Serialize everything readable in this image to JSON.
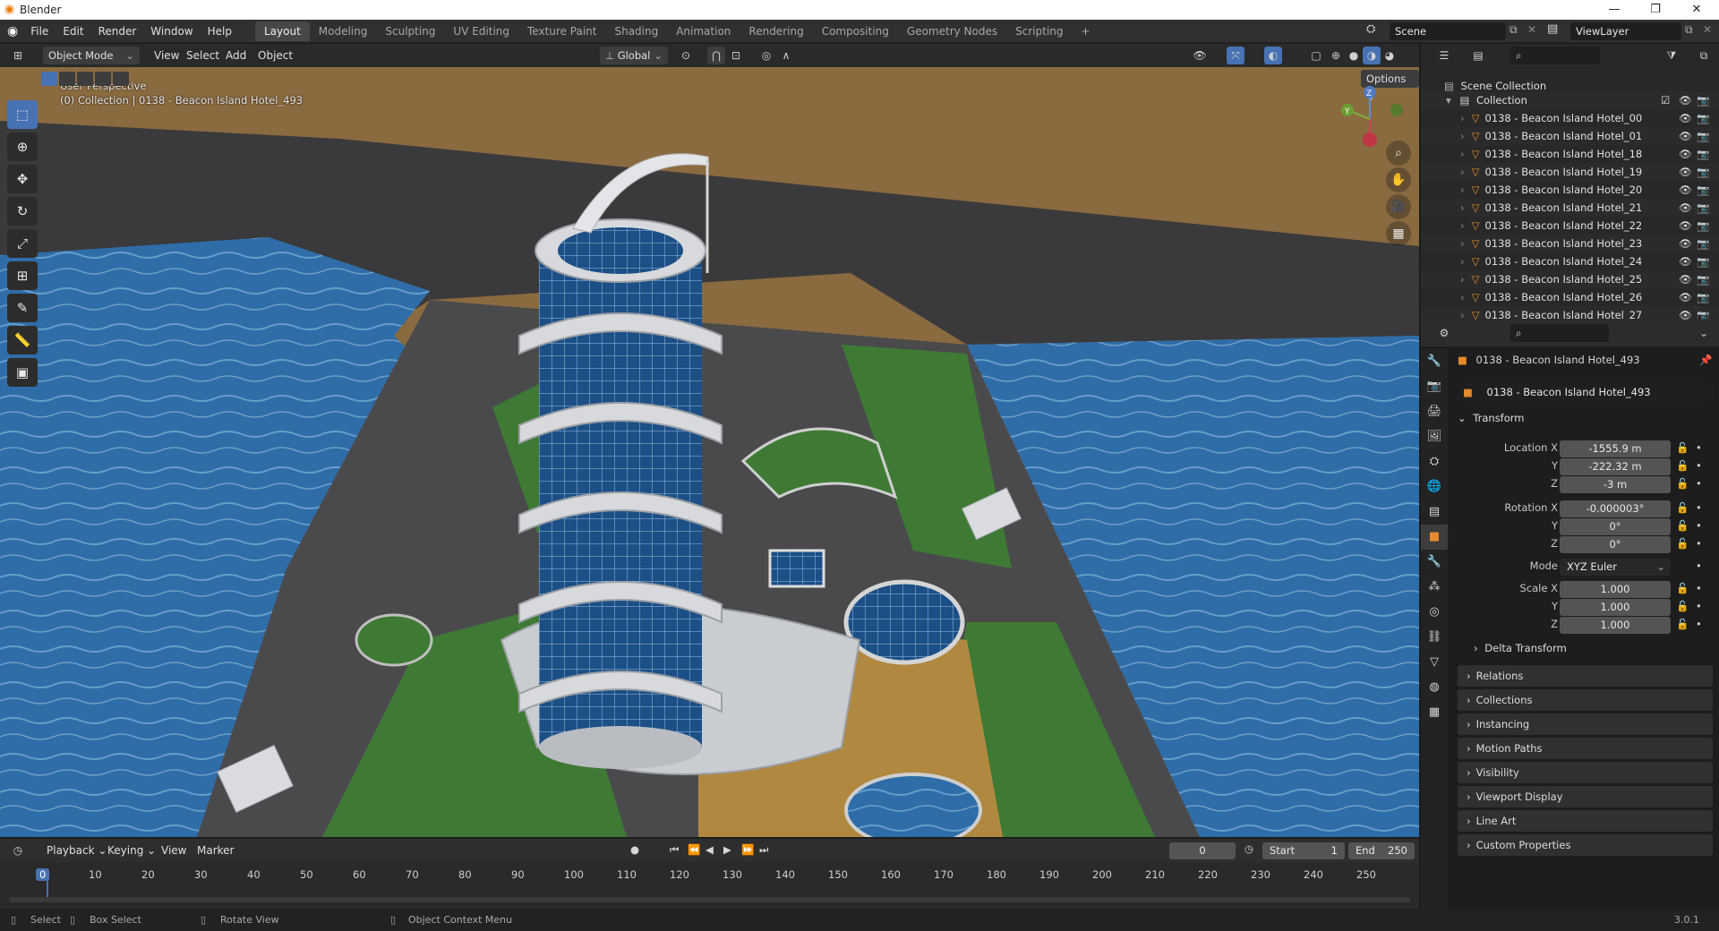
{
  "window": {
    "title": "Blender",
    "minimize": "—",
    "maximize": "❐",
    "close": "✕"
  },
  "menu": [
    "File",
    "Edit",
    "Render",
    "Window",
    "Help"
  ],
  "workspaces": [
    "Layout",
    "Modeling",
    "Sculpting",
    "UV Editing",
    "Texture Paint",
    "Shading",
    "Animation",
    "Rendering",
    "Compositing",
    "Geometry Nodes",
    "Scripting",
    "+"
  ],
  "active_workspace": "Layout",
  "scene": {
    "name": "Scene",
    "view_layer": "ViewLayer"
  },
  "viewport_header": {
    "mode": "Object Mode",
    "menus": [
      "View",
      "Select",
      "Add",
      "Object"
    ],
    "transform_orientation": "Global",
    "options": "Options"
  },
  "viewport": {
    "perspective": "User Perspective",
    "collection_info": "(0) Collection | 0138 - Beacon Island Hotel_493",
    "gizmo": {
      "x": "X",
      "y": "Y",
      "z": "Z"
    }
  },
  "outliner": {
    "root": "Scene Collection",
    "collection": "Collection",
    "items": [
      "0138 - Beacon Island Hotel_00",
      "0138 - Beacon Island Hotel_01",
      "0138 - Beacon Island Hotel_18",
      "0138 - Beacon Island Hotel_19",
      "0138 - Beacon Island Hotel_20",
      "0138 - Beacon Island Hotel_21",
      "0138 - Beacon Island Hotel_22",
      "0138 - Beacon Island Hotel_23",
      "0138 - Beacon Island Hotel_24",
      "0138 - Beacon Island Hotel_25",
      "0138 - Beacon Island Hotel_26",
      "0138 - Beacon Island Hotel_27"
    ]
  },
  "properties": {
    "object_title": "0138 - Beacon Island Hotel_493",
    "object_name": "0138 - Beacon Island Hotel_493",
    "transform_label": "Transform",
    "location": {
      "label": "Location X",
      "x": "-1555.9 m",
      "y": "-222.32 m",
      "z": "-3 m"
    },
    "rotation": {
      "label": "Rotation X",
      "x": "-0.000003°",
      "y": "0°",
      "z": "0°"
    },
    "mode": {
      "label": "Mode",
      "value": "XYZ Euler"
    },
    "scale": {
      "label": "Scale X",
      "x": "1.000",
      "y": "1.000",
      "z": "1.000"
    },
    "axis_y": "Y",
    "axis_z": "Z",
    "delta_transform": "Delta Transform",
    "panels": [
      "Relations",
      "Collections",
      "Instancing",
      "Motion Paths",
      "Visibility",
      "Viewport Display",
      "Line Art",
      "Custom Properties"
    ]
  },
  "timeline": {
    "menus": [
      "Playback",
      "Keying",
      "View",
      "Marker"
    ],
    "current_frame": "0",
    "start_label": "Start",
    "start": "1",
    "end_label": "End",
    "end": "250",
    "frames": [
      "0",
      "10",
      "20",
      "30",
      "40",
      "50",
      "60",
      "70",
      "80",
      "90",
      "100",
      "110",
      "120",
      "130",
      "140",
      "150",
      "160",
      "170",
      "180",
      "190",
      "200",
      "210",
      "220",
      "230",
      "240",
      "250"
    ]
  },
  "statusbar": {
    "select": "Select",
    "box_select": "Box Select",
    "rotate_view": "Rotate View",
    "context_menu": "Object Context Menu",
    "version": "3.0.1"
  },
  "colors": {
    "accent": "#4772b3",
    "water": "#2f6da8",
    "grass": "#3e7a34",
    "sand": "#8a6a3f"
  }
}
